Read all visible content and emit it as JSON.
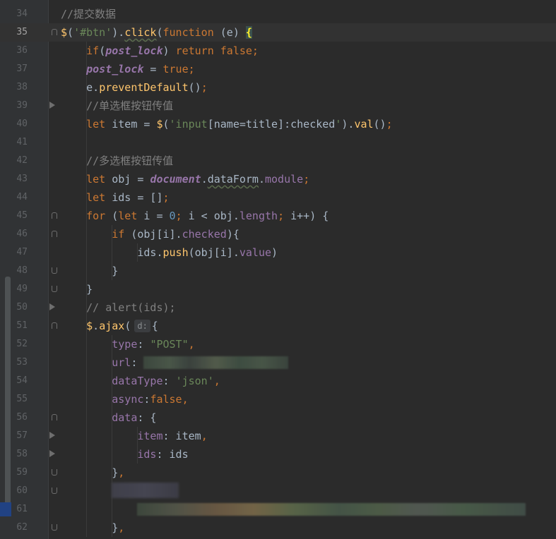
{
  "editor": {
    "current_line": 35,
    "lines": [
      {
        "n": "34",
        "tokens": [
          {
            "c": "cmt",
            "t": "//提交数据"
          }
        ]
      },
      {
        "n": "35",
        "tokens": [
          {
            "c": "fn",
            "t": "$"
          },
          {
            "t": "("
          },
          {
            "c": "str",
            "t": "'#btn'"
          },
          {
            "t": ")."
          },
          {
            "c": "fn wavy",
            "t": "click"
          },
          {
            "t": "("
          },
          {
            "c": "kw",
            "t": "function "
          },
          {
            "t": "(e) "
          },
          {
            "c": "brace-hl",
            "t": "{"
          }
        ]
      },
      {
        "n": "36",
        "tokens": [
          {
            "t": "    "
          },
          {
            "c": "kw",
            "t": "if"
          },
          {
            "t": "("
          },
          {
            "c": "pvar",
            "t": "post_lock"
          },
          {
            "t": ") "
          },
          {
            "c": "kw",
            "t": "return false;"
          }
        ]
      },
      {
        "n": "37",
        "tokens": [
          {
            "t": "    "
          },
          {
            "c": "pvar",
            "t": "post_lock"
          },
          {
            "t": " = "
          },
          {
            "c": "kw",
            "t": "true;"
          }
        ]
      },
      {
        "n": "38",
        "tokens": [
          {
            "t": "    e."
          },
          {
            "c": "fn",
            "t": "preventDefault"
          },
          {
            "t": "()"
          },
          {
            "c": "kw",
            "t": ";"
          }
        ]
      },
      {
        "n": "39",
        "tokens": [
          {
            "t": "    "
          },
          {
            "c": "cmt",
            "t": "//单选框按钮传值"
          }
        ]
      },
      {
        "n": "40",
        "tokens": [
          {
            "t": "    "
          },
          {
            "c": "kw",
            "t": "let "
          },
          {
            "t": "item = "
          },
          {
            "c": "fn",
            "t": "$"
          },
          {
            "t": "("
          },
          {
            "c": "str",
            "t": "'input"
          },
          {
            "t": "[name=title]:checked"
          },
          {
            "c": "str",
            "t": "'"
          },
          {
            "t": ")."
          },
          {
            "c": "fn",
            "t": "val"
          },
          {
            "t": "()"
          },
          {
            "c": "kw",
            "t": ";"
          }
        ]
      },
      {
        "n": "41",
        "tokens": []
      },
      {
        "n": "42",
        "tokens": [
          {
            "t": "    "
          },
          {
            "c": "cmt",
            "t": "//多选框按钮传值"
          }
        ]
      },
      {
        "n": "43",
        "tokens": [
          {
            "t": "    "
          },
          {
            "c": "kw",
            "t": "let "
          },
          {
            "t": "obj = "
          },
          {
            "c": "glob",
            "t": "document"
          },
          {
            "t": "."
          },
          {
            "c": "wavy",
            "t": "dataForm"
          },
          {
            "t": "."
          },
          {
            "c": "prop",
            "t": "module"
          },
          {
            "c": "kw",
            "t": ";"
          }
        ]
      },
      {
        "n": "44",
        "tokens": [
          {
            "t": "    "
          },
          {
            "c": "kw",
            "t": "let "
          },
          {
            "t": "ids = []"
          },
          {
            "c": "kw",
            "t": ";"
          }
        ]
      },
      {
        "n": "45",
        "tokens": [
          {
            "t": "    "
          },
          {
            "c": "kw",
            "t": "for "
          },
          {
            "t": "("
          },
          {
            "c": "kw",
            "t": "let "
          },
          {
            "t": "i = "
          },
          {
            "c": "num",
            "t": "0"
          },
          {
            "c": "kw",
            "t": "; "
          },
          {
            "t": "i < obj."
          },
          {
            "c": "prop",
            "t": "length"
          },
          {
            "c": "kw",
            "t": "; "
          },
          {
            "t": "i++) {"
          }
        ]
      },
      {
        "n": "46",
        "tokens": [
          {
            "t": "        "
          },
          {
            "c": "kw",
            "t": "if "
          },
          {
            "t": "(obj[i]."
          },
          {
            "c": "prop",
            "t": "checked"
          },
          {
            "t": "){"
          }
        ]
      },
      {
        "n": "47",
        "tokens": [
          {
            "t": "            ids."
          },
          {
            "c": "fn",
            "t": "push"
          },
          {
            "t": "(obj[i]."
          },
          {
            "c": "prop",
            "t": "value"
          },
          {
            "t": ")"
          }
        ]
      },
      {
        "n": "48",
        "tokens": [
          {
            "t": "        }"
          }
        ]
      },
      {
        "n": "49",
        "tokens": [
          {
            "t": "    }"
          }
        ]
      },
      {
        "n": "50",
        "tokens": [
          {
            "t": "    "
          },
          {
            "c": "cmt",
            "t": "// alert(ids);"
          }
        ]
      },
      {
        "n": "51",
        "tokens": [
          {
            "t": "    "
          },
          {
            "c": "fn",
            "t": "$"
          },
          {
            "t": "."
          },
          {
            "c": "fn",
            "t": "ajax"
          },
          {
            "t": "("
          },
          {
            "c": "hint",
            "t": "d:"
          },
          {
            "t": "{"
          }
        ]
      },
      {
        "n": "52",
        "tokens": [
          {
            "t": "        "
          },
          {
            "c": "prop",
            "t": "type"
          },
          {
            "t": ": "
          },
          {
            "c": "str",
            "t": "\"POST\""
          },
          {
            "c": "kw",
            "t": ","
          }
        ]
      },
      {
        "n": "53",
        "tokens": [
          {
            "t": "        "
          },
          {
            "c": "prop",
            "t": "url"
          },
          {
            "t": ": "
          },
          {
            "c": "blur",
            "t": "",
            "w": 205
          }
        ]
      },
      {
        "n": "54",
        "tokens": [
          {
            "t": "        "
          },
          {
            "c": "prop",
            "t": "dataType"
          },
          {
            "t": ": "
          },
          {
            "c": "str",
            "t": "'json'"
          },
          {
            "c": "kw",
            "t": ","
          }
        ]
      },
      {
        "n": "55",
        "tokens": [
          {
            "t": "        "
          },
          {
            "c": "prop",
            "t": "async"
          },
          {
            "t": ":"
          },
          {
            "c": "kw",
            "t": "false,"
          }
        ]
      },
      {
        "n": "56",
        "tokens": [
          {
            "t": "        "
          },
          {
            "c": "prop",
            "t": "data"
          },
          {
            "t": ": {"
          }
        ]
      },
      {
        "n": "57",
        "tokens": [
          {
            "t": "            "
          },
          {
            "c": "prop",
            "t": "item"
          },
          {
            "t": ": item"
          },
          {
            "c": "kw",
            "t": ","
          }
        ]
      },
      {
        "n": "58",
        "tokens": [
          {
            "t": "            "
          },
          {
            "c": "prop",
            "t": "ids"
          },
          {
            "t": ": ids"
          }
        ]
      },
      {
        "n": "59",
        "tokens": [
          {
            "t": "        }"
          },
          {
            "c": "kw",
            "t": ","
          }
        ]
      },
      {
        "n": "60",
        "tokens": [
          {
            "t": "        "
          },
          {
            "c": "blur3",
            "t": "",
            "w": 95
          }
        ]
      },
      {
        "n": "61",
        "tokens": [
          {
            "t": "            "
          },
          {
            "c": "blur2",
            "t": "",
            "w": 550
          }
        ]
      },
      {
        "n": "62",
        "tokens": [
          {
            "t": "        }"
          },
          {
            "c": "kw",
            "t": ","
          }
        ]
      }
    ]
  }
}
